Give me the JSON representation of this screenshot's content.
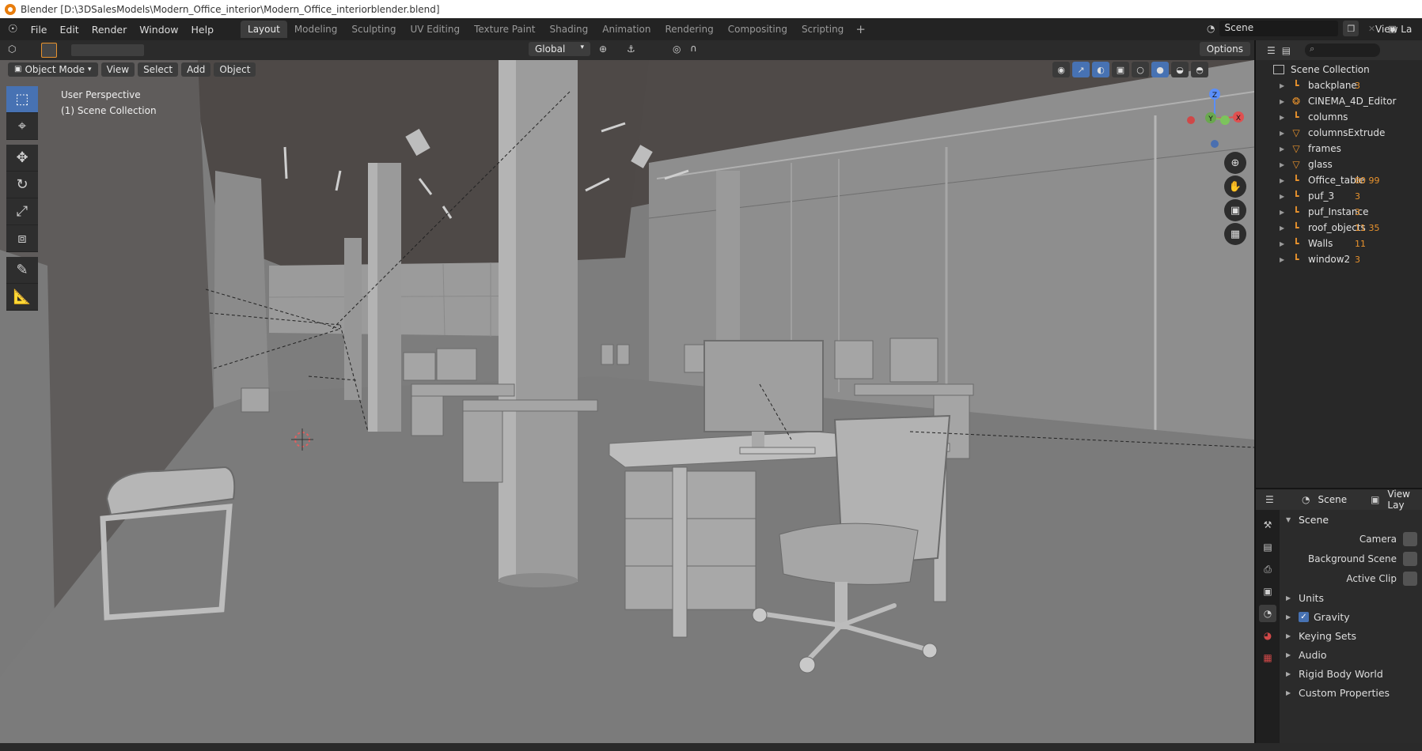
{
  "window": {
    "title": "Blender [D:\\3DSalesModels\\Modern_Office_interior\\Modern_Office_interiorblender.blend]"
  },
  "menu": {
    "items": [
      "File",
      "Edit",
      "Render",
      "Window",
      "Help"
    ]
  },
  "workspaces": {
    "tabs": [
      "Layout",
      "Modeling",
      "Sculpting",
      "UV Editing",
      "Texture Paint",
      "Shading",
      "Animation",
      "Rendering",
      "Compositing",
      "Scripting"
    ],
    "add": "+"
  },
  "scene_selector": {
    "value": "Scene",
    "view_layer": "View La"
  },
  "viewport_header": {
    "mode": "Object Mode",
    "menus": [
      "View",
      "Select",
      "Add",
      "Object"
    ],
    "orientation": "Global",
    "options": "Options"
  },
  "viewport": {
    "perspective_label": "User Perspective",
    "collection_label": "(1) Scene Collection",
    "gizmo_axes": {
      "z": "Z",
      "y": "Y",
      "x": "X"
    },
    "colors": {
      "background": "#7d7d7d",
      "accent": "#4772b3"
    }
  },
  "outliner": {
    "search_placeholder": "",
    "root": "Scene Collection",
    "items": [
      {
        "name": "backplane",
        "suffix": "3"
      },
      {
        "name": "CINEMA_4D_Editor",
        "suffix": ""
      },
      {
        "name": "columns",
        "suffix": ""
      },
      {
        "name": "columnsExtrude",
        "suffix": ""
      },
      {
        "name": "frames",
        "suffix": ""
      },
      {
        "name": "glass",
        "suffix": ""
      },
      {
        "name": "Office_table",
        "suffix": "80  99"
      },
      {
        "name": "puf_3",
        "suffix": "3"
      },
      {
        "name": "puf_Instance",
        "suffix": "3"
      },
      {
        "name": "roof_objects",
        "suffix": "11  35"
      },
      {
        "name": "Walls",
        "suffix": "11"
      },
      {
        "name": "window2",
        "suffix": "3"
      }
    ]
  },
  "properties": {
    "header_scene": "Scene",
    "header_view_layer": "View Lay",
    "panel_title": "Scene",
    "fields": [
      "Camera",
      "Background Scene",
      "Active Clip"
    ],
    "subpanels": [
      "Units",
      "Gravity",
      "Keying Sets",
      "Audio",
      "Rigid Body World",
      "Custom Properties"
    ]
  }
}
